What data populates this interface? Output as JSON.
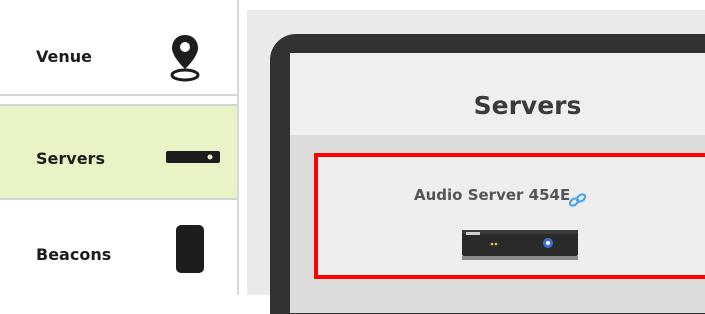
{
  "sidebar": {
    "items": [
      {
        "label": "Venue",
        "icon": "location-pin-icon",
        "active": false
      },
      {
        "label": "Servers",
        "icon": "server-device-icon",
        "active": true
      },
      {
        "label": "Beacons",
        "icon": "beacon-device-icon",
        "active": false
      }
    ]
  },
  "screen": {
    "title": "Servers",
    "server": {
      "name": "Audio Server 454E",
      "link_icon": "link-icon",
      "device_icon": "audio-server-device-icon"
    }
  },
  "colors": {
    "active_nav": "#e8f4c6",
    "highlight_border": "#ff0000",
    "link": "#4ea6e8",
    "tablet_frame": "#323232"
  }
}
